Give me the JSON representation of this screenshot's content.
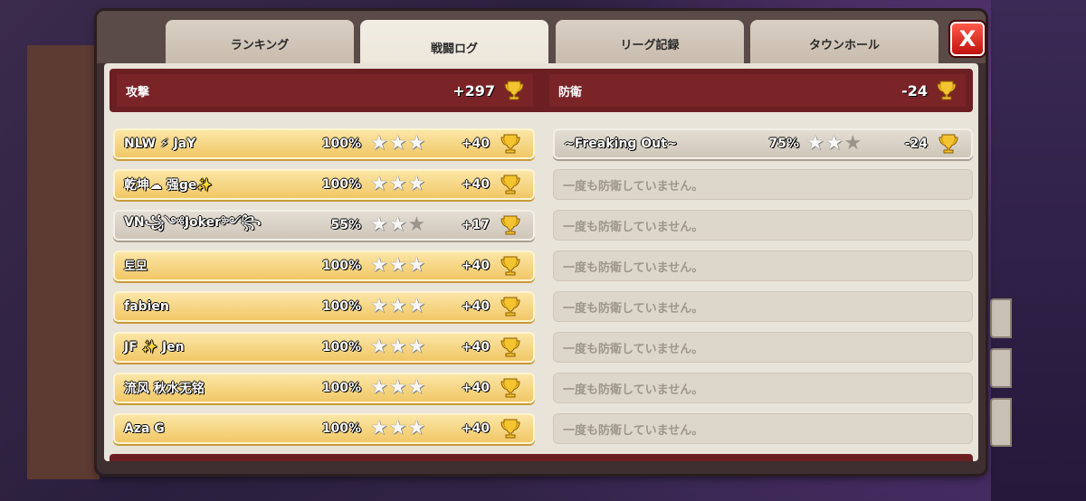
{
  "tabs": [
    "ランキング",
    "戦闘ログ",
    "リーグ記録",
    "タウンホール"
  ],
  "active_tab": 1,
  "close_label": "X",
  "summary": {
    "attack_label": "攻撃",
    "attack_value": "+297",
    "defense_label": "防衛",
    "defense_value": "-24"
  },
  "attacks": [
    {
      "name": "NLW ⚡ JaY",
      "percent": "100%",
      "stars": 3,
      "trophies": "+40",
      "result": "win"
    },
    {
      "name": "乾坤☁ 强ge✨",
      "percent": "100%",
      "stars": 3,
      "trophies": "+40",
      "result": "win"
    },
    {
      "name": "VN꧁༺Joker༻꧂",
      "percent": "55%",
      "stars": 2,
      "trophies": "+17",
      "result": "partial"
    },
    {
      "name": "토모",
      "percent": "100%",
      "stars": 3,
      "trophies": "+40",
      "result": "win"
    },
    {
      "name": "fabien",
      "percent": "100%",
      "stars": 3,
      "trophies": "+40",
      "result": "win"
    },
    {
      "name": "JF ✨ Jen",
      "percent": "100%",
      "stars": 3,
      "trophies": "+40",
      "result": "win"
    },
    {
      "name": "流风 秋水无铭",
      "percent": "100%",
      "stars": 3,
      "trophies": "+40",
      "result": "win"
    },
    {
      "name": "Aza G",
      "percent": "100%",
      "stars": 3,
      "trophies": "+40",
      "result": "win"
    }
  ],
  "defenses": [
    {
      "name": "~Freaking Out~",
      "percent": "75%",
      "stars": 2,
      "trophies": "-24"
    },
    {
      "empty_text": "一度も防衛していません。"
    },
    {
      "empty_text": "一度も防衛していません。"
    },
    {
      "empty_text": "一度も防衛していません。"
    },
    {
      "empty_text": "一度も防衛していません。"
    },
    {
      "empty_text": "一度も防衛していません。"
    },
    {
      "empty_text": "一度も防衛していません。"
    },
    {
      "empty_text": "一度も防衛していません。"
    }
  ],
  "colors": {
    "win_row": "#f1c766",
    "summary_bg": "#6b1f22",
    "panel_bg": "#e9e4da"
  },
  "icons": {
    "trophy": "trophy-icon",
    "star": "star-icon",
    "close": "close-icon"
  }
}
